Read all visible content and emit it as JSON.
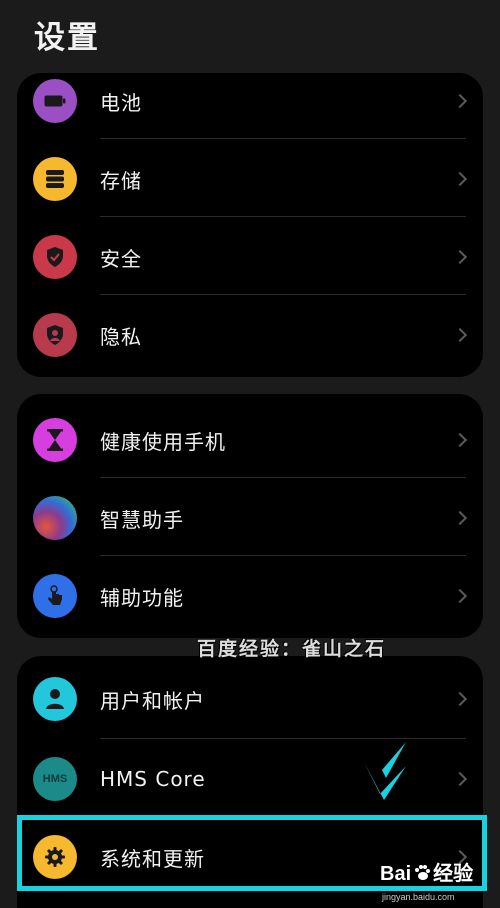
{
  "header": {
    "title": "设置"
  },
  "group1": [
    {
      "label": "电池",
      "icon": "battery-icon",
      "color": "#9b4fc4"
    },
    {
      "label": "存储",
      "icon": "storage-icon",
      "color": "#f5b82e"
    },
    {
      "label": "安全",
      "icon": "shield-icon",
      "color": "#c9394a"
    },
    {
      "label": "隐私",
      "icon": "privacy-icon",
      "color": "#b83a4d"
    }
  ],
  "group2": [
    {
      "label": "健康使用手机",
      "icon": "hourglass-icon",
      "color": "#d63ee0"
    },
    {
      "label": "智慧助手",
      "icon": "assistant-icon",
      "color": "#3b8ad4"
    },
    {
      "label": "辅助功能",
      "icon": "accessibility-hand-icon",
      "color": "#2f6fe8"
    }
  ],
  "group3": [
    {
      "label": "用户和帐户",
      "icon": "user-icon",
      "color": "#22c7dc"
    },
    {
      "label": "HMS Core",
      "icon": "hms-icon",
      "color": "#1d8a8a",
      "icon_text": "HMS"
    },
    {
      "label": "系统和更新",
      "icon": "gear-icon",
      "color": "#f5b82e"
    }
  ],
  "overlay": {
    "watermark": "百度经验：雀山之石",
    "baidu_logo": "Bai",
    "baidu_logo_suffix": "经验",
    "baidu_url": "jingyan.baidu.com",
    "highlight_color": "#19d2e0"
  }
}
